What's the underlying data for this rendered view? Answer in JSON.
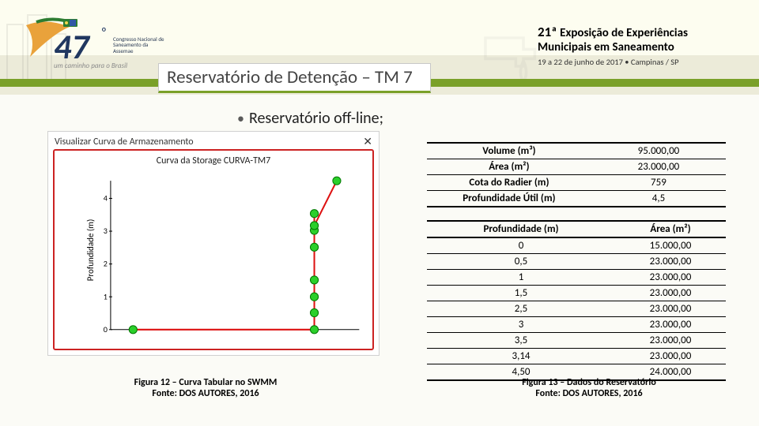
{
  "header": {
    "logo": {
      "number": "47",
      "ord": "º",
      "small1": "Congresso Nacional de",
      "small2": "Saneamento da Assemae",
      "tagline": "um caminho para o Brasil"
    },
    "event": {
      "line1_a": "21ª ",
      "line1_b": "Exposição de Experiências",
      "line2": "Municipais em Saneamento",
      "line3": "19 a 22 de junho de 2017 • Campinas / SP"
    }
  },
  "title": "Reservatório de Detenção – TM 7",
  "bullet": "Reservatório off-line;",
  "chart": {
    "window_title": "Visualizar Curva de Armazenamento",
    "close": "✕",
    "subtitle": "Curva da Storage CURVA-TM7",
    "ylabel": "Profundidade (m)"
  },
  "chart_data": {
    "type": "line",
    "title": "Curva da Storage CURVA-TM7",
    "ylabel": "Profundidade (m)",
    "xlabel": "",
    "ylim": [
      0,
      4.5
    ],
    "series": [
      {
        "name": "CURVA-TM7",
        "points": [
          {
            "x": 15000,
            "y": 0
          },
          {
            "x": 23000,
            "y": 0
          },
          {
            "x": 23000,
            "y": 0.5
          },
          {
            "x": 23000,
            "y": 1
          },
          {
            "x": 23000,
            "y": 1.5
          },
          {
            "x": 23000,
            "y": 2.5
          },
          {
            "x": 23000,
            "y": 3
          },
          {
            "x": 23000,
            "y": 3.5
          },
          {
            "x": 23000,
            "y": 3.14
          },
          {
            "x": 24000,
            "y": 4.5
          }
        ]
      }
    ],
    "xlim": [
      14000,
      25000
    ],
    "yticks": [
      0,
      1,
      2,
      3,
      4
    ]
  },
  "tables": {
    "props": [
      {
        "label": "Volume (m³)",
        "value": "95.000,00"
      },
      {
        "label": "Área (m²)",
        "value": "23.000,00"
      },
      {
        "label": "Cota do Radier (m)",
        "value": "759"
      },
      {
        "label": "Profundidade Útil (m)",
        "value": "4,5"
      }
    ],
    "depth_area": {
      "headers": [
        "Profundidade (m)",
        "Área (m²)"
      ],
      "rows": [
        [
          "0",
          "15.000,00"
        ],
        [
          "0,5",
          "23.000,00"
        ],
        [
          "1",
          "23.000,00"
        ],
        [
          "1,5",
          "23.000,00"
        ],
        [
          "2,5",
          "23.000,00"
        ],
        [
          "3",
          "23.000,00"
        ],
        [
          "3,5",
          "23.000,00"
        ],
        [
          "3,14",
          "23.000,00"
        ],
        [
          "4,50",
          "24.000,00"
        ]
      ]
    }
  },
  "captions": {
    "left_a": "Figura 12 – Curva Tabular  no SWMM",
    "left_b": "Fonte: DOS AUTORES, 2016",
    "right_a": "Figura 13 – Dados do Reservatório",
    "right_b": "Fonte: DOS AUTORES, 2016"
  }
}
